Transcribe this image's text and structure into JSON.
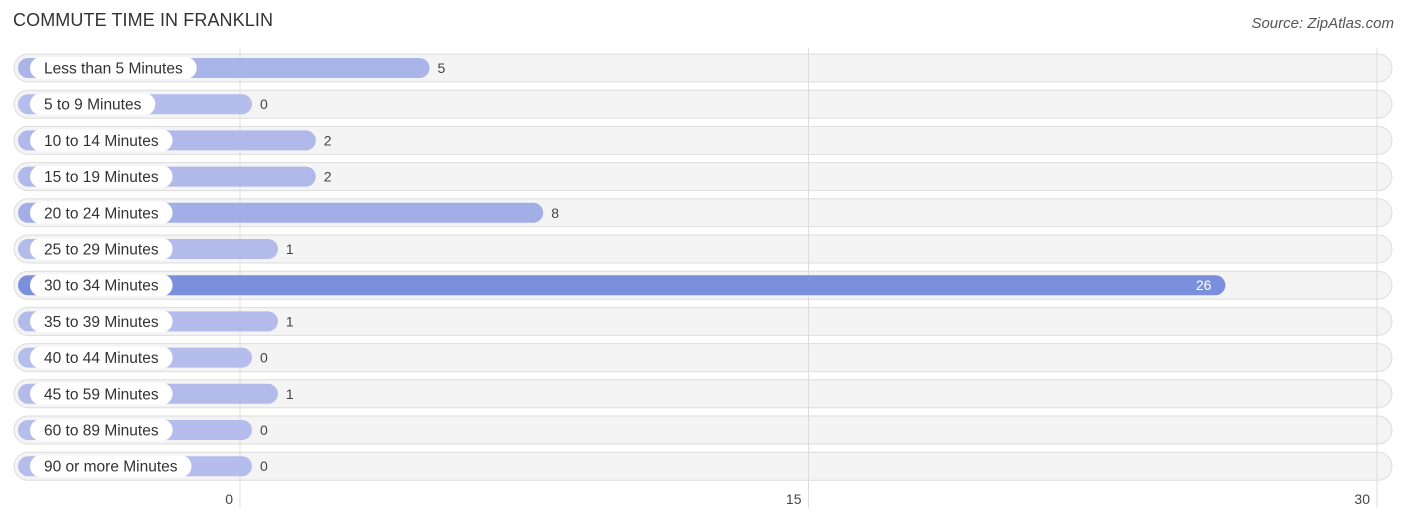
{
  "chart_data": {
    "type": "bar",
    "orientation": "horizontal",
    "title": "COMMUTE TIME IN FRANKLIN",
    "source": "Source: ZipAtlas.com",
    "xlabel": "",
    "ylabel": "",
    "categories": [
      "Less than 5 Minutes",
      "5 to 9 Minutes",
      "10 to 14 Minutes",
      "15 to 19 Minutes",
      "20 to 24 Minutes",
      "25 to 29 Minutes",
      "30 to 34 Minutes",
      "35 to 39 Minutes",
      "40 to 44 Minutes",
      "45 to 59 Minutes",
      "60 to 89 Minutes",
      "90 or more Minutes"
    ],
    "values": [
      5,
      0,
      2,
      2,
      8,
      1,
      26,
      1,
      0,
      1,
      0,
      0
    ],
    "xlim": [
      0,
      30
    ],
    "xticks": [
      0,
      15,
      30
    ],
    "grid": true,
    "legend": "none",
    "colors": {
      "bar_light": "#b4bdeb",
      "bar_dark": "#7b8fdc",
      "row_bg": "#f4f4f4"
    }
  }
}
